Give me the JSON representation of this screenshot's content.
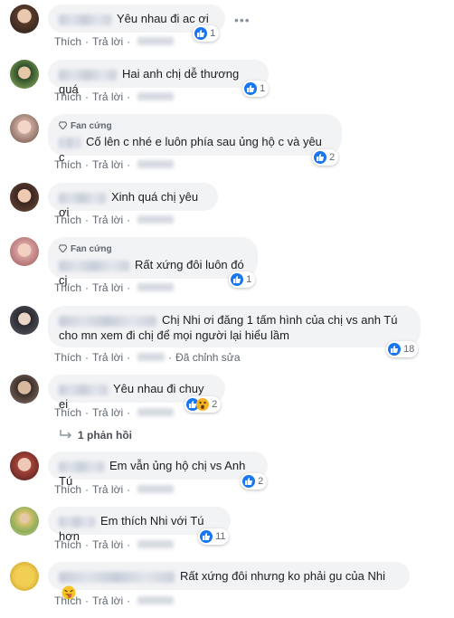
{
  "labels": {
    "like": "Thích",
    "reply": "Trả lời",
    "edited": "Đã chỉnh sửa",
    "dot": "·"
  },
  "badge": "Fan cứng",
  "more_icon": "more-options-icon",
  "replies_label": "1 phản hồi",
  "comments": [
    {
      "text": "Yêu nhau đi ac ơi",
      "reactions": "1"
    },
    {
      "text": "Hai anh chị dễ thương quá",
      "reactions": "1"
    },
    {
      "text": "Cố lên c nhé e luôn phía sau ủng hộ c và yêu c",
      "reactions": "2"
    },
    {
      "text": "Xinh quá chị yêu ơi"
    },
    {
      "text": "Rất xứng đôi luôn đó cj",
      "reactions": "1"
    },
    {
      "text_line1": "Chị Nhi ơi đăng 1 tấm hình của chị vs anh Tú",
      "text_line2": "cho mn xem đi chị để mọi người lại hiểu lầm",
      "reactions": "18"
    },
    {
      "text": "Yêu nhau đi chuy ei",
      "reactions": "2"
    },
    {
      "text": "Em vẫn ủng hộ chị vs Anh Tú",
      "reactions": "2"
    },
    {
      "text": "Em thích Nhi với Tú hơn",
      "reactions": "11"
    },
    {
      "text": "Rất xứng đôi nhưng ko phải gu của Nhi"
    }
  ],
  "colors": {
    "like_blue": "#1877f2",
    "bubble_bg": "#f2f3f5",
    "secondary_text": "#606770"
  }
}
